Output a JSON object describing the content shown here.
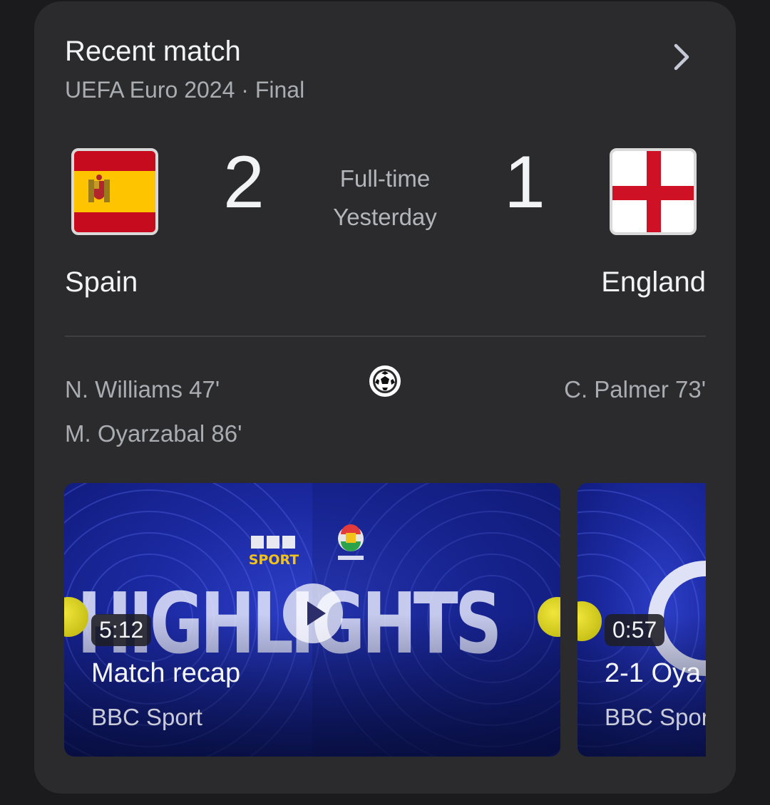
{
  "card": {
    "title": "Recent match",
    "subtitle": "UEFA Euro 2024 · Final",
    "more_icon": "chevron-right-icon"
  },
  "match": {
    "home": {
      "name": "Spain",
      "score": "2",
      "flag_icon": "spain-flag-icon"
    },
    "away": {
      "name": "England",
      "score": "1",
      "flag_icon": "england-flag-icon"
    },
    "status": "Full-time",
    "date": "Yesterday",
    "goal_icon": "soccer-ball-icon",
    "home_scorers": [
      "N. Williams 47'",
      "M. Oyarzabal 86'"
    ],
    "away_scorers": [
      "C. Palmer 73'"
    ]
  },
  "videos": [
    {
      "duration": "5:12",
      "title": "Match recap",
      "source": "BBC Sport",
      "thumb_text": "HIGHLIGHTS",
      "logo_text": "SPORT"
    },
    {
      "duration": "0:57",
      "title": "2-1 Oya",
      "source": "BBC Spor"
    }
  ],
  "colors": {
    "card_bg": "#2b2b2e",
    "page_bg": "#1b1b1d",
    "thumb_blue": "#1c2aa3",
    "spain_red": "#c60b1e",
    "spain_yellow": "#ffc400",
    "england_red": "#ce1124"
  }
}
